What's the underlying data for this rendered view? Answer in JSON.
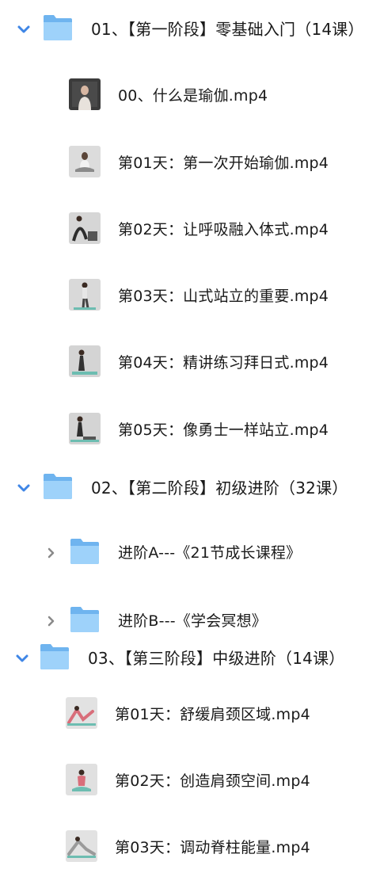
{
  "colors": {
    "accent": "#3f86e6",
    "folder_back": "#6fb4ef",
    "folder_front": "#9ed2fa",
    "text": "#1a1a1a"
  },
  "tree": {
    "stage1": {
      "label": "01、【第一阶段】零基础入门（14课）",
      "expanded": true,
      "files": [
        {
          "label": "00、什么是瑜伽.mp4",
          "thumb": "video-thumbnail"
        },
        {
          "label": "第01天：第一次开始瑜伽.mp4",
          "thumb": "video-thumbnail"
        },
        {
          "label": "第02天：让呼吸融入体式.mp4",
          "thumb": "video-thumbnail"
        },
        {
          "label": "第03天：山式站立的重要.mp4",
          "thumb": "video-thumbnail"
        },
        {
          "label": "第04天：精讲练习拜日式.mp4",
          "thumb": "video-thumbnail"
        },
        {
          "label": "第05天：像勇士一样站立.mp4",
          "thumb": "video-thumbnail"
        }
      ]
    },
    "stage2": {
      "label": "02、【第二阶段】初级进阶（32课）",
      "expanded": true,
      "folders": [
        {
          "label": "进阶A---《21节成长课程》",
          "expanded": false
        },
        {
          "label": "进阶B---《学会冥想》",
          "expanded": false
        }
      ]
    },
    "stage3": {
      "label": "03、【第三阶段】中级进阶（14课）",
      "expanded": true,
      "files": [
        {
          "label": "第01天：舒缓肩颈区域.mp4",
          "thumb": "video-thumbnail"
        },
        {
          "label": "第02天：创造肩颈空间.mp4",
          "thumb": "video-thumbnail"
        },
        {
          "label": "第03天：调动脊柱能量.mp4",
          "thumb": "video-thumbnail"
        }
      ]
    }
  }
}
